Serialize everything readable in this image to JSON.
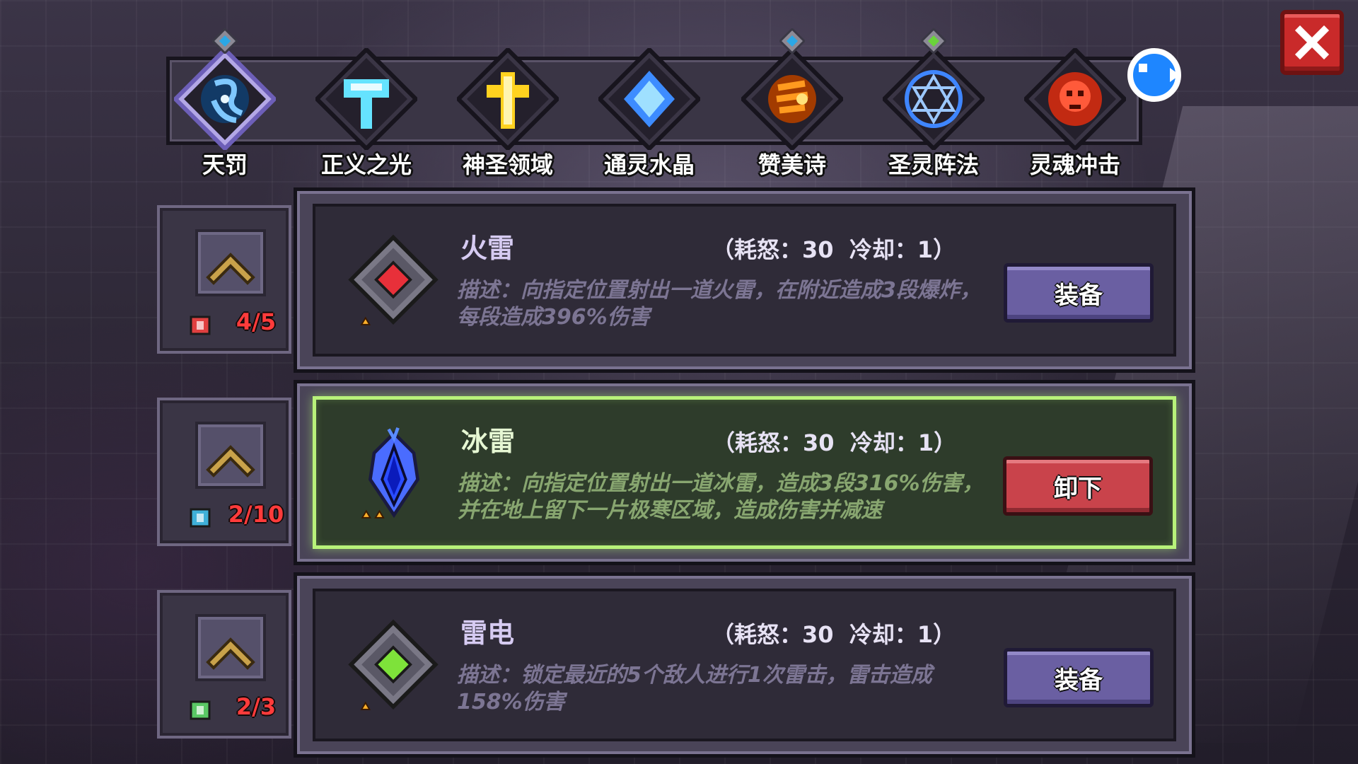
{
  "close": {
    "icon": "close-icon"
  },
  "tabs": [
    {
      "label": "天罚",
      "icon": "lightning-swirl-icon",
      "color": "#7fc8ff",
      "gem": "#2aa7e6",
      "selected": true
    },
    {
      "label": "正义之光",
      "icon": "hammer-icon",
      "color": "#65e3ff",
      "gem": null,
      "selected": false
    },
    {
      "label": "神圣领域",
      "icon": "holy-cross-icon",
      "color": "#ffd21f",
      "gem": null,
      "selected": false
    },
    {
      "label": "通灵水晶",
      "icon": "crystal-icon",
      "color": "#3d8cff",
      "gem": null,
      "selected": false
    },
    {
      "label": "赞美诗",
      "icon": "music-note-icon",
      "color": "#ff9a1f",
      "gem": "#2aa7e6",
      "selected": false
    },
    {
      "label": "圣灵阵法",
      "icon": "magic-circle-icon",
      "color": "#3f86ff",
      "gem": "#6ad43a",
      "selected": false
    },
    {
      "label": "灵魂冲击",
      "icon": "soul-skull-icon",
      "color": "#ff5a3a",
      "gem": null,
      "selected": false
    }
  ],
  "cycle_icon": "cycle-icon",
  "upgrades": [
    {
      "count": "4/5",
      "material_color": "#e04040"
    },
    {
      "count": "2/10",
      "material_color": "#3fb0d8"
    },
    {
      "count": "2/3",
      "material_color": "#5ac864"
    }
  ],
  "skills": [
    {
      "name": "火雷",
      "stats": "（耗怒：30  冷却：1）",
      "description": "描述：向指定位置射出一道火雷，在附近造成3段爆炸，每段造成396%伤害",
      "button": "装备",
      "button_type": "equip",
      "icon": "fire-rune-icon",
      "icon_color": "#e8303a",
      "stars": 1,
      "active": false
    },
    {
      "name": "冰雷",
      "stats": "（耗怒：30  冷却：1）",
      "description": "描述：向指定位置射出一道冰雷，造成3段316%伤害，并在地上留下一片极寒区域，造成伤害并减速",
      "button": "卸下",
      "button_type": "unequip",
      "icon": "ice-rune-icon",
      "icon_color": "#2a4cff",
      "stars": 2,
      "active": true
    },
    {
      "name": "雷电",
      "stats": "（耗怒：30  冷却：1）",
      "description": "描述：锁定最近的5个敌人进行1次雷击，雷击造成158%伤害",
      "button": "装备",
      "button_type": "equip",
      "icon": "lightning-rune-icon",
      "icon_color": "#7ee23a",
      "stars": 1,
      "active": false
    }
  ]
}
